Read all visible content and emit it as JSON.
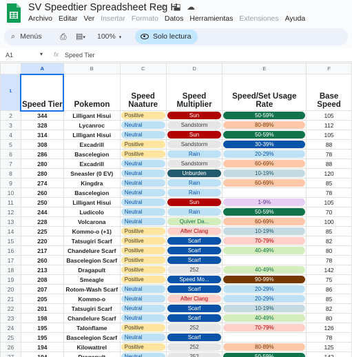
{
  "app": {
    "title": "SV Speedtier Spreadsheet Reg H",
    "menu": [
      {
        "label": "Archivo",
        "enabled": true
      },
      {
        "label": "Editar",
        "enabled": true
      },
      {
        "label": "Ver",
        "enabled": true
      },
      {
        "label": "Insertar",
        "enabled": false
      },
      {
        "label": "Formato",
        "enabled": false
      },
      {
        "label": "Datos",
        "enabled": true
      },
      {
        "label": "Herramientas",
        "enabled": true
      },
      {
        "label": "Extensiones",
        "enabled": false
      },
      {
        "label": "Ayuda",
        "enabled": true
      }
    ]
  },
  "toolbar": {
    "search_label": "Menús",
    "zoom": "100%",
    "readonly_label": "Solo lectura"
  },
  "formula_bar": {
    "cell_ref": "A1",
    "fx": "fx",
    "value": "Speed Tier"
  },
  "columns": [
    "A",
    "B",
    "C",
    "D",
    "E",
    "F"
  ],
  "headers": {
    "row_num": "1",
    "speed_tier": "Speed Tier",
    "pokemon": "Pokemon",
    "nature": "Speed Naature",
    "multiplier": "Speed Multiplier",
    "usage": "Speed/Set Usage Rate",
    "base_speed": "Base Speed"
  },
  "colors": {
    "positive_bg": "#ffe5a0",
    "positive_fg": "#473821",
    "neutral_bg": "#bfe1f6",
    "neutral_fg": "#0a53a8",
    "red_bg": "#b10202",
    "red_fg": "#ffffff",
    "gray_bg": "#e6e6e6",
    "gray_fg": "#3d3d3d",
    "teal_bg": "#215a6c",
    "teal_fg": "#ffffff",
    "lightred_bg": "#ffcfc9",
    "lightred_fg": "#b10202",
    "green_bg": "#d4edbc",
    "green_fg": "#11734b",
    "blue_bg": "#0a53a8",
    "blue_fg": "#ffffff",
    "darkgreen_bg": "#11734b",
    "darkgreen_fg": "#ffffff",
    "salmon_bg": "#ffc8aa",
    "salmon_fg": "#753800",
    "purple_bg": "#e6cff2",
    "purple_fg": "#5a3286",
    "brown_bg": "#753800",
    "brown_fg": "#ffffff",
    "lightblue_bg": "#c6dbe1",
    "lightblue_fg": "#215a6c",
    "lightgreen_bg": "#d4edbc",
    "lightgreen_fg": "#11734b"
  },
  "rows": [
    {
      "row": "2",
      "tier": "344",
      "pokemon": "Lilligant Hisui",
      "nature": "Positive",
      "nature_style": "positive",
      "mult": "Sun",
      "mult_style": "red",
      "usage": "50-59%",
      "usage_style": "darkgreen",
      "base": "105"
    },
    {
      "row": "3",
      "tier": "328",
      "pokemon": "Lycanroc",
      "nature": "Neutral",
      "nature_style": "neutral",
      "mult": "Sandstorm",
      "mult_style": "gray",
      "usage": "80-89%",
      "usage_style": "salmon",
      "base": "112"
    },
    {
      "row": "4",
      "tier": "314",
      "pokemon": "Lilligant Hisui",
      "nature": "Neutral",
      "nature_style": "neutral",
      "mult": "Sun",
      "mult_style": "red",
      "usage": "50-59%",
      "usage_style": "darkgreen",
      "base": "105"
    },
    {
      "row": "5",
      "tier": "308",
      "pokemon": "Excadrill",
      "nature": "Positive",
      "nature_style": "positive",
      "mult": "Sandstorm",
      "mult_style": "gray",
      "usage": "30-39%",
      "usage_style": "blue",
      "base": "88"
    },
    {
      "row": "6",
      "tier": "286",
      "pokemon": "Bascelegion",
      "nature": "Positive",
      "nature_style": "positive",
      "mult": "Rain",
      "mult_style": "neutral",
      "usage": "20-29%",
      "usage_style": "neutral",
      "base": "78"
    },
    {
      "row": "7",
      "tier": "280",
      "pokemon": "Excadrill",
      "nature": "Neutral",
      "nature_style": "neutral",
      "mult": "Sandstorm",
      "mult_style": "gray",
      "usage": "60-69%",
      "usage_style": "salmon",
      "base": "88"
    },
    {
      "row": "8",
      "tier": "280",
      "pokemon": "Sneasler (0 EV)",
      "nature": "Neutral",
      "nature_style": "neutral",
      "mult": "Unburden",
      "mult_style": "teal",
      "usage": "10-19%",
      "usage_style": "lightblue",
      "base": "120"
    },
    {
      "row": "9",
      "tier": "274",
      "pokemon": "Kingdra",
      "nature": "Neutral",
      "nature_style": "neutral",
      "mult": "Rain",
      "mult_style": "neutral",
      "usage": "60-69%",
      "usage_style": "salmon",
      "base": "85"
    },
    {
      "row": "10",
      "tier": "260",
      "pokemon": "Bascelegion",
      "nature": "Neutral",
      "nature_style": "neutral",
      "mult": "Rain",
      "mult_style": "neutral",
      "usage": "",
      "usage_style": "none",
      "base": "78"
    },
    {
      "row": "11",
      "tier": "250",
      "pokemon": "Lilligant Hisui",
      "nature": "Neutral",
      "nature_style": "neutral",
      "mult": "Sun",
      "mult_style": "red",
      "usage": "1-9%",
      "usage_style": "purple",
      "base": "105"
    },
    {
      "row": "12",
      "tier": "244",
      "pokemon": "Ludicolo",
      "nature": "Neutral",
      "nature_style": "neutral",
      "mult": "Rain",
      "mult_style": "neutral",
      "usage": "50-59%",
      "usage_style": "darkgreen",
      "base": "70"
    },
    {
      "row": "13",
      "tier": "228",
      "pokemon": "Volcarona",
      "nature": "Neutral",
      "nature_style": "neutral",
      "mult": "Quiver Da...",
      "mult_style": "lightgreen",
      "usage": "60-69%",
      "usage_style": "salmon",
      "base": "100"
    },
    {
      "row": "14",
      "tier": "225",
      "pokemon": "Kommo-o (+1)",
      "nature": "Positive",
      "nature_style": "positive",
      "mult": "After Clang",
      "mult_style": "lightred",
      "usage": "10-19%",
      "usage_style": "lightblue",
      "base": "85"
    },
    {
      "row": "15",
      "tier": "220",
      "pokemon": "Tatsugiri Scarf",
      "nature": "Positive",
      "nature_style": "positive",
      "mult": "Scarf",
      "mult_style": "blue",
      "usage": "70-79%",
      "usage_style": "lightred",
      "base": "82"
    },
    {
      "row": "16",
      "tier": "217",
      "pokemon": "Chandelure Scarf",
      "nature": "Positive",
      "nature_style": "positive",
      "mult": "Scarf",
      "mult_style": "blue",
      "usage": "40-49%",
      "usage_style": "green",
      "base": "80"
    },
    {
      "row": "17",
      "tier": "260",
      "pokemon": "Bascelegion Scarf",
      "nature": "Positive",
      "nature_style": "positive",
      "mult": "Scarf",
      "mult_style": "blue",
      "usage": "",
      "usage_style": "none",
      "base": "78"
    },
    {
      "row": "18",
      "tier": "213",
      "pokemon": "Dragapult",
      "nature": "Positive",
      "nature_style": "positive",
      "mult": "252",
      "mult_style": "gray",
      "usage": "40-49%",
      "usage_style": "green",
      "base": "142"
    },
    {
      "row": "19",
      "tier": "208",
      "pokemon": "Smeagle",
      "nature": "Positive",
      "nature_style": "positive",
      "mult": "Speed Mo...",
      "mult_style": "blue",
      "usage": "90-99%",
      "usage_style": "brown",
      "base": "75"
    },
    {
      "row": "20",
      "tier": "207",
      "pokemon": "Rotom-Wash Scarf",
      "nature": "Neutral",
      "nature_style": "neutral",
      "mult": "Scarf",
      "mult_style": "blue",
      "usage": "20-29%",
      "usage_style": "neutral",
      "base": "86"
    },
    {
      "row": "21",
      "tier": "205",
      "pokemon": "Kommo-o",
      "nature": "Neutral",
      "nature_style": "neutral",
      "mult": "After Clang",
      "mult_style": "lightred",
      "usage": "20-29%",
      "usage_style": "neutral",
      "base": "85"
    },
    {
      "row": "22",
      "tier": "201",
      "pokemon": "Tatsugiri Scarf",
      "nature": "Neutral",
      "nature_style": "neutral",
      "mult": "Scarf",
      "mult_style": "blue",
      "usage": "10-19%",
      "usage_style": "lightblue",
      "base": "82"
    },
    {
      "row": "23",
      "tier": "198",
      "pokemon": "Chandelure Scarf",
      "nature": "Neutral",
      "nature_style": "neutral",
      "mult": "Scarf",
      "mult_style": "blue",
      "usage": "40-49%",
      "usage_style": "green",
      "base": "80"
    },
    {
      "row": "24",
      "tier": "195",
      "pokemon": "Talonflame",
      "nature": "Positive",
      "nature_style": "positive",
      "mult": "252",
      "mult_style": "gray",
      "usage": "70-79%",
      "usage_style": "lightred",
      "base": "126"
    },
    {
      "row": "25",
      "tier": "195",
      "pokemon": "Bascelegion Scarf",
      "nature": "Neutral",
      "nature_style": "neutral",
      "mult": "Scarf",
      "mult_style": "blue",
      "usage": "",
      "usage_style": "none",
      "base": "78"
    },
    {
      "row": "26",
      "tier": "194",
      "pokemon": "Kilowattrel",
      "nature": "Positive",
      "nature_style": "positive",
      "mult": "252",
      "mult_style": "gray",
      "usage": "80-89%",
      "usage_style": "salmon",
      "base": "125"
    },
    {
      "row": "27",
      "tier": "194",
      "pokemon": "Dragapult",
      "nature": "Neutral",
      "nature_style": "neutral",
      "mult": "252",
      "mult_style": "gray",
      "usage": "50-59%",
      "usage_style": "darkgreen",
      "base": "142"
    }
  ]
}
